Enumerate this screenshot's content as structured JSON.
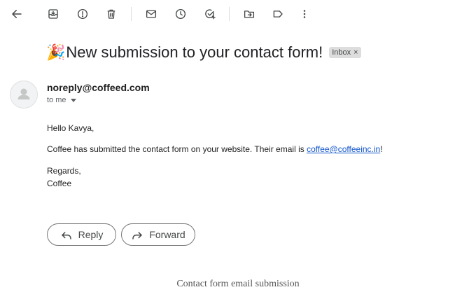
{
  "toolbar": {
    "icons": [
      "back-arrow-icon",
      "archive-icon",
      "report-spam-icon",
      "delete-icon",
      "mark-unread-icon",
      "snooze-icon",
      "add-to-tasks-icon",
      "move-to-icon",
      "label-icon",
      "more-options-icon"
    ]
  },
  "email": {
    "subject_emoji": "🎉",
    "subject": "New submission to your contact form!",
    "label_badge": "Inbox",
    "label_remove": "×",
    "sender": "noreply@coffeed.com",
    "recipient": "to me",
    "greeting": "Hello Kavya,",
    "body_before_link": "Coffee has submitted the contact form on your website. Their email is ",
    "body_link": "coffee@coffeeinc.in",
    "body_after_link": "!",
    "sign_off": "Regards,",
    "signature": "Coffee"
  },
  "actions": {
    "reply_label": "Reply",
    "forward_label": "Forward"
  },
  "caption": "Contact form email submission",
  "colors": {
    "link": "#1155cc",
    "badge_bg": "#dddddd",
    "button_border": "#747775"
  }
}
